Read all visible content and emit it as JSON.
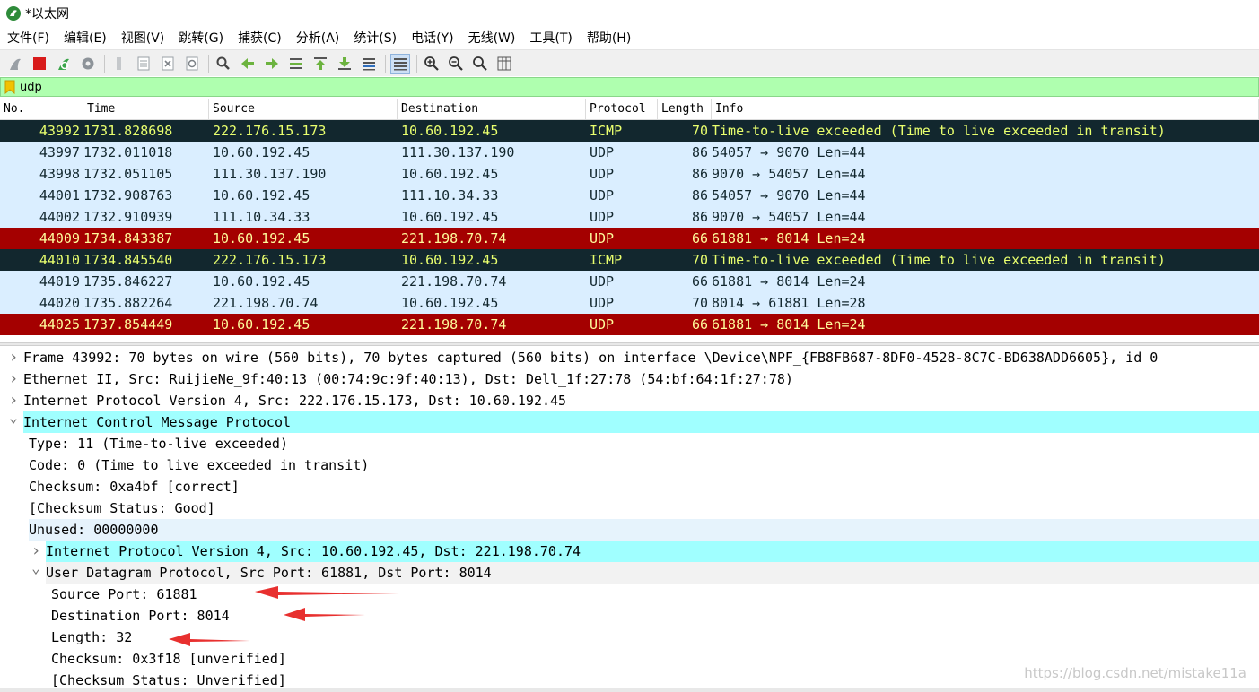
{
  "window": {
    "title": "*以太网"
  },
  "menu": [
    "文件(F)",
    "编辑(E)",
    "视图(V)",
    "跳转(G)",
    "捕获(C)",
    "分析(A)",
    "统计(S)",
    "电话(Y)",
    "无线(W)",
    "工具(T)",
    "帮助(H)"
  ],
  "toolbar": {
    "buttons": [
      "shark-fin-start-icon",
      "stop-icon",
      "restart-icon",
      "options-gear-icon",
      "open-file-icon",
      "save-file-icon",
      "close-file-icon",
      "reload-icon",
      "find-packet-icon",
      "go-back-icon",
      "go-forward-icon",
      "go-to-packet-icon",
      "go-first-icon",
      "go-last-icon",
      "autoscroll-icon",
      "colorize-icon",
      "zoom-in-icon",
      "zoom-out-icon",
      "zoom-reset-icon",
      "resize-columns-icon"
    ]
  },
  "filter": {
    "value": "udp"
  },
  "packet_list": {
    "headers": {
      "no": "No.",
      "time": "Time",
      "source": "Source",
      "destination": "Destination",
      "protocol": "Protocol",
      "length": "Length",
      "info": "Info"
    },
    "rows": [
      {
        "no": "43992",
        "time": "1731.828698",
        "source": "222.176.15.173",
        "destination": "10.60.192.45",
        "protocol": "ICMP",
        "length": "70",
        "info": "Time-to-live exceeded (Time to live exceeded in transit)",
        "style": "icmp"
      },
      {
        "no": "43997",
        "time": "1732.011018",
        "source": "10.60.192.45",
        "destination": "111.30.137.190",
        "protocol": "UDP",
        "length": "86",
        "info": "54057 → 9070 Len=44",
        "style": "udp"
      },
      {
        "no": "43998",
        "time": "1732.051105",
        "source": "111.30.137.190",
        "destination": "10.60.192.45",
        "protocol": "UDP",
        "length": "86",
        "info": "9070 → 54057 Len=44",
        "style": "udp"
      },
      {
        "no": "44001",
        "time": "1732.908763",
        "source": "10.60.192.45",
        "destination": "111.10.34.33",
        "protocol": "UDP",
        "length": "86",
        "info": "54057 → 9070 Len=44",
        "style": "udp"
      },
      {
        "no": "44002",
        "time": "1732.910939",
        "source": "111.10.34.33",
        "destination": "10.60.192.45",
        "protocol": "UDP",
        "length": "86",
        "info": "9070 → 54057 Len=44",
        "style": "udp"
      },
      {
        "no": "44009",
        "time": "1734.843387",
        "source": "10.60.192.45",
        "destination": "221.198.70.74",
        "protocol": "UDP",
        "length": "66",
        "info": "61881 → 8014 Len=24",
        "style": "bad"
      },
      {
        "no": "44010",
        "time": "1734.845540",
        "source": "222.176.15.173",
        "destination": "10.60.192.45",
        "protocol": "ICMP",
        "length": "70",
        "info": "Time-to-live exceeded (Time to live exceeded in transit)",
        "style": "icmp"
      },
      {
        "no": "44019",
        "time": "1735.846227",
        "source": "10.60.192.45",
        "destination": "221.198.70.74",
        "protocol": "UDP",
        "length": "66",
        "info": "61881 → 8014 Len=24",
        "style": "udp"
      },
      {
        "no": "44020",
        "time": "1735.882264",
        "source": "221.198.70.74",
        "destination": "10.60.192.45",
        "protocol": "UDP",
        "length": "70",
        "info": "8014 → 61881 Len=28",
        "style": "udp"
      },
      {
        "no": "44025",
        "time": "1737.854449",
        "source": "10.60.192.45",
        "destination": "221.198.70.74",
        "protocol": "UDP",
        "length": "66",
        "info": "61881 → 8014 Len=24",
        "style": "bad"
      }
    ]
  },
  "details": [
    {
      "text": "Frame 43992: 70 bytes on wire (560 bits), 70 bytes captured (560 bits) on interface \\Device\\NPF_{FB8FB687-8DF0-4528-8C7C-BD638ADD6605}, id 0",
      "arrow": "collapsed",
      "indent": 0,
      "hl": ""
    },
    {
      "text": "Ethernet II, Src: RuijieNe_9f:40:13 (00:74:9c:9f:40:13), Dst: Dell_1f:27:78 (54:bf:64:1f:27:78)",
      "arrow": "collapsed",
      "indent": 0,
      "hl": ""
    },
    {
      "text": "Internet Protocol Version 4, Src: 222.176.15.173, Dst: 10.60.192.45",
      "arrow": "collapsed",
      "indent": 0,
      "hl": ""
    },
    {
      "text": "Internet Control Message Protocol",
      "arrow": "expanded",
      "indent": 0,
      "hl": "cyan"
    },
    {
      "text": "Type: 11 (Time-to-live exceeded)",
      "arrow": "none",
      "indent": 1,
      "hl": ""
    },
    {
      "text": "Code: 0 (Time to live exceeded in transit)",
      "arrow": "none",
      "indent": 1,
      "hl": ""
    },
    {
      "text": "Checksum: 0xa4bf [correct]",
      "arrow": "none",
      "indent": 1,
      "hl": ""
    },
    {
      "text": "[Checksum Status: Good]",
      "arrow": "none",
      "indent": 1,
      "hl": ""
    },
    {
      "text": "Unused: 00000000",
      "arrow": "none",
      "indent": 1,
      "hl": "lightblue"
    },
    {
      "text": "Internet Protocol Version 4, Src: 10.60.192.45, Dst: 221.198.70.74",
      "arrow": "collapsed",
      "indent": 1,
      "hl": "cyan"
    },
    {
      "text": "User Datagram Protocol, Src Port: 61881, Dst Port: 8014",
      "arrow": "expanded",
      "indent": 1,
      "hl": "grey"
    },
    {
      "text": "Source Port: 61881",
      "arrow": "none",
      "indent": 2,
      "hl": ""
    },
    {
      "text": "Destination Port: 8014",
      "arrow": "none",
      "indent": 2,
      "hl": ""
    },
    {
      "text": "Length: 32",
      "arrow": "none",
      "indent": 2,
      "hl": ""
    },
    {
      "text": "Checksum: 0x3f18 [unverified]",
      "arrow": "none",
      "indent": 2,
      "hl": ""
    },
    {
      "text": "[Checksum Status: Unverified]",
      "arrow": "none",
      "indent": 2,
      "hl": ""
    }
  ],
  "watermark": "https://blog.csdn.net/mistake11a",
  "colors": {
    "icmp_bg": "#12272e",
    "icmp_fg": "#e9ff6e",
    "udp_bg": "#daeeff",
    "bad_bg": "#a40000",
    "bad_fg": "#fffc9c",
    "filter_bg": "#afffaf",
    "annotation": "#e8302f"
  }
}
